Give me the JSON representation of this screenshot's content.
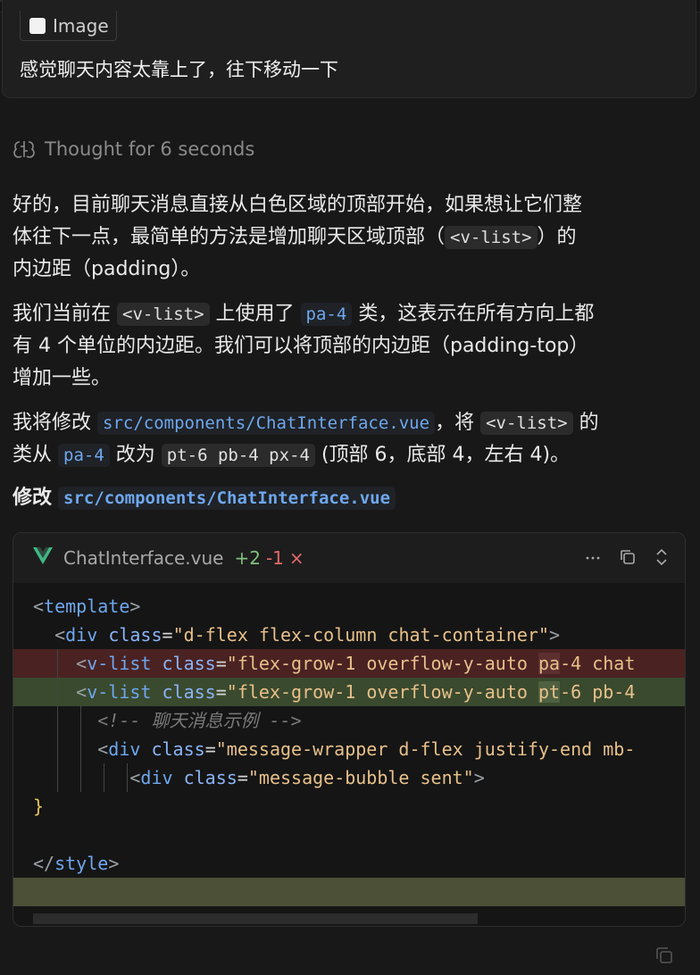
{
  "user_message": {
    "attachment_label": "Image",
    "text": "感觉聊天内容太靠上了，往下移动一下"
  },
  "thought": {
    "label": "Thought for 6 seconds"
  },
  "reply": {
    "p1": {
      "l1": "好的，目前聊天消息直接从白色区域的顶部开始，如果想让它们整",
      "l2a": "体往下一点，最简单的方法是增加聊天区域顶部（",
      "l2code": "<v-list>",
      "l2b": "）的",
      "l3": "内边距（padding）。"
    },
    "p2": {
      "l1a": "我们当前在",
      "l1code": "<v-list>",
      "l1b": "上使用了",
      "l1code2": "pa-4",
      "l1c": "类，这表示在所有方向上都",
      "l2": "有 4 个单位的内边距。我们可以将顶部的内边距（padding-top）",
      "l3": "增加一些。"
    },
    "p3": {
      "l1a": "我将修改",
      "l1code": "src/components/ChatInterface.vue",
      "l1b": "，将",
      "l1code2": "<v-list>",
      "l1c": "的",
      "l2a": "类从",
      "l2code": "pa-4",
      "l2b": "改为",
      "l2code2": "pt-6 pb-4 px-4",
      "l2c": "(顶部 6，底部 4，左右 4)。"
    },
    "edit_heading": {
      "prefix": "修改",
      "path": "src/components/ChatInterface.vue"
    }
  },
  "code_card": {
    "filename": "ChatInterface.vue",
    "additions": "+2",
    "deletions": "-1",
    "reject_glyph": "×",
    "lines": {
      "l1": "template",
      "l2_tag": "div",
      "l2_attr": "class",
      "l2_val": "\"d-flex flex-column chat-container\"",
      "l3_tag": "v-list",
      "l3_attr": "class",
      "l3_val_a": "\"flex-grow-1 overflow-y-auto ",
      "l3_mark": "pa",
      "l3_val_b": "-4 chat",
      "l4_tag": "v-list",
      "l4_attr": "class",
      "l4_val_a": "\"flex-grow-1 overflow-y-auto ",
      "l4_mark": "pt",
      "l4_val_b": "-6 pb-4",
      "l5_comment": "<!-- 聊天消息示例 -->",
      "l6_tag": "div",
      "l6_attr": "class",
      "l6_val": "\"message-wrapper d-flex justify-end mb-",
      "l7_tag": "div",
      "l7_attr": "class",
      "l7_val": "\"message-bubble sent\"",
      "l8": "}",
      "l10": "style"
    }
  },
  "icons": {
    "brain": "brain-icon",
    "vue": "vue-icon",
    "more": "more-icon",
    "copy": "copy-icon",
    "expand": "expand-icon"
  },
  "colors": {
    "background": "#181818",
    "added_line": "#3a4a2e",
    "deleted_line": "#4a2222",
    "code_path": "#6ea7ee"
  }
}
